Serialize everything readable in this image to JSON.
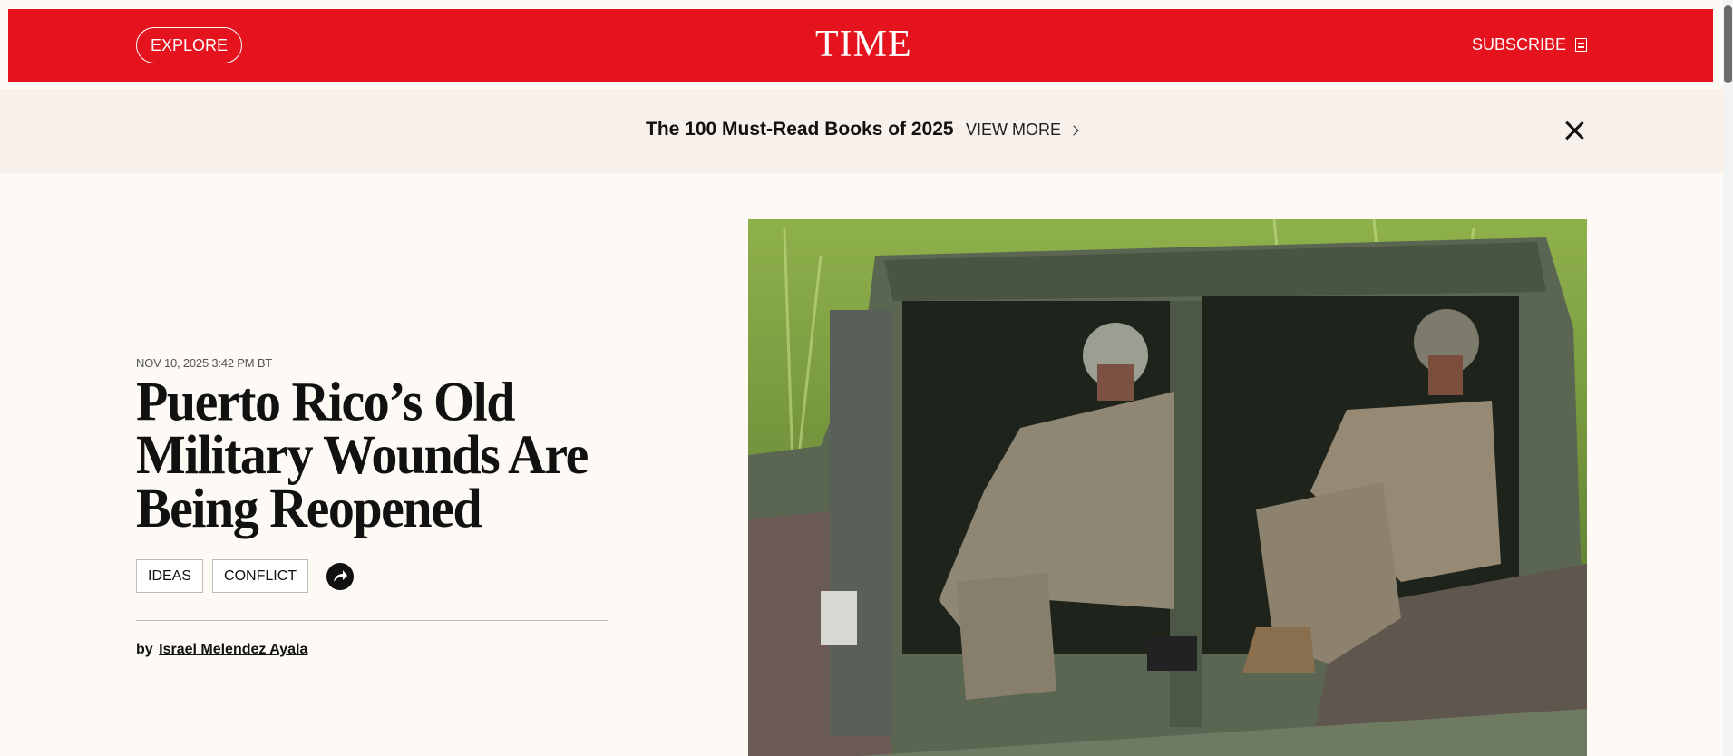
{
  "header": {
    "explore_label": "EXPLORE",
    "logo": "TIME",
    "subscribe_label": "SUBSCRIBE",
    "brand_color": "#e5131d"
  },
  "promo": {
    "title": "The 100 Must-Read Books of 2025",
    "view_more": "VIEW MORE"
  },
  "article": {
    "date": "NOV 10, 2025 3:42 PM BT",
    "headline": "Puerto Rico’s Old Military Wounds Are Being Reopened",
    "tags": [
      "IDEAS",
      "CONFLICT"
    ],
    "byline_prefix": "by",
    "author": "Israel Melendez Ayala"
  },
  "hero_image": {
    "subject": "two-soldiers-in-military-vehicle"
  }
}
